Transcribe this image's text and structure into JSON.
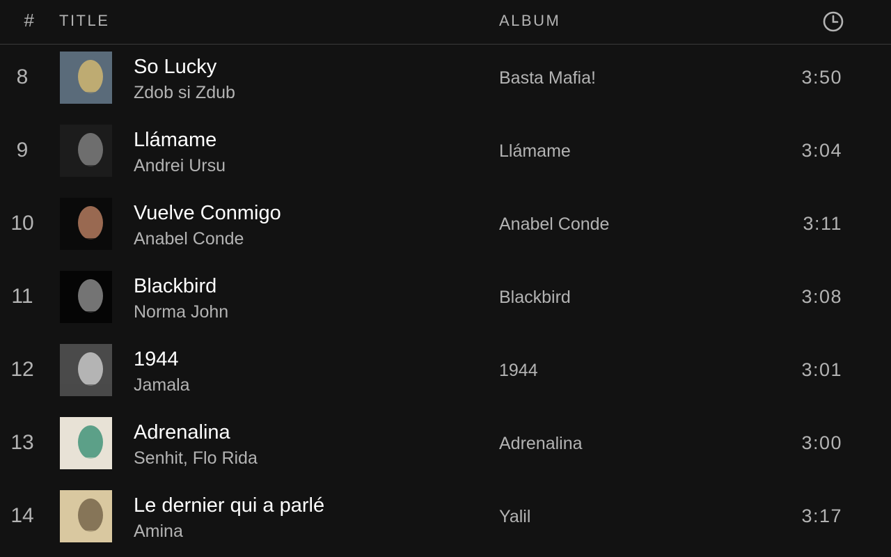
{
  "header": {
    "number_label": "#",
    "title_label": "TITLE",
    "album_label": "ALBUM",
    "duration_icon": "clock-icon"
  },
  "tracks": [
    {
      "number": "8",
      "title": "So Lucky",
      "artist": "Zdob si Zdub",
      "album": "Basta Mafia!",
      "duration": "3:50",
      "art_colors": [
        "#5a6b7a",
        "#e0c070"
      ]
    },
    {
      "number": "9",
      "title": "Llámame",
      "artist": "Andrei Ursu",
      "album": "Llámame",
      "duration": "3:04",
      "art_colors": [
        "#1c1c1c",
        "#8a8a8a"
      ]
    },
    {
      "number": "10",
      "title": "Vuelve Conmigo",
      "artist": "Anabel Conde",
      "album": "Anabel Conde",
      "duration": "3:11",
      "art_colors": [
        "#0a0a0a",
        "#c98a6a"
      ]
    },
    {
      "number": "11",
      "title": "Blackbird",
      "artist": "Norma John",
      "album": "Blackbird",
      "duration": "3:08",
      "art_colors": [
        "#050505",
        "#9a9a9a"
      ]
    },
    {
      "number": "12",
      "title": "1944",
      "artist": "Jamala",
      "album": "1944",
      "duration": "3:01",
      "art_colors": [
        "#4a4a4a",
        "#d8d8d8"
      ]
    },
    {
      "number": "13",
      "title": "Adrenalina",
      "artist": "Senhit, Flo Rida",
      "album": "Adrenalina",
      "duration": "3:00",
      "art_colors": [
        "#e8e2d6",
        "#2e8a6e"
      ]
    },
    {
      "number": "14",
      "title": "Le dernier qui a parlé",
      "artist": "Amina",
      "album": "Yalil",
      "duration": "3:17",
      "art_colors": [
        "#d9c8a0",
        "#6a5a40"
      ]
    }
  ]
}
